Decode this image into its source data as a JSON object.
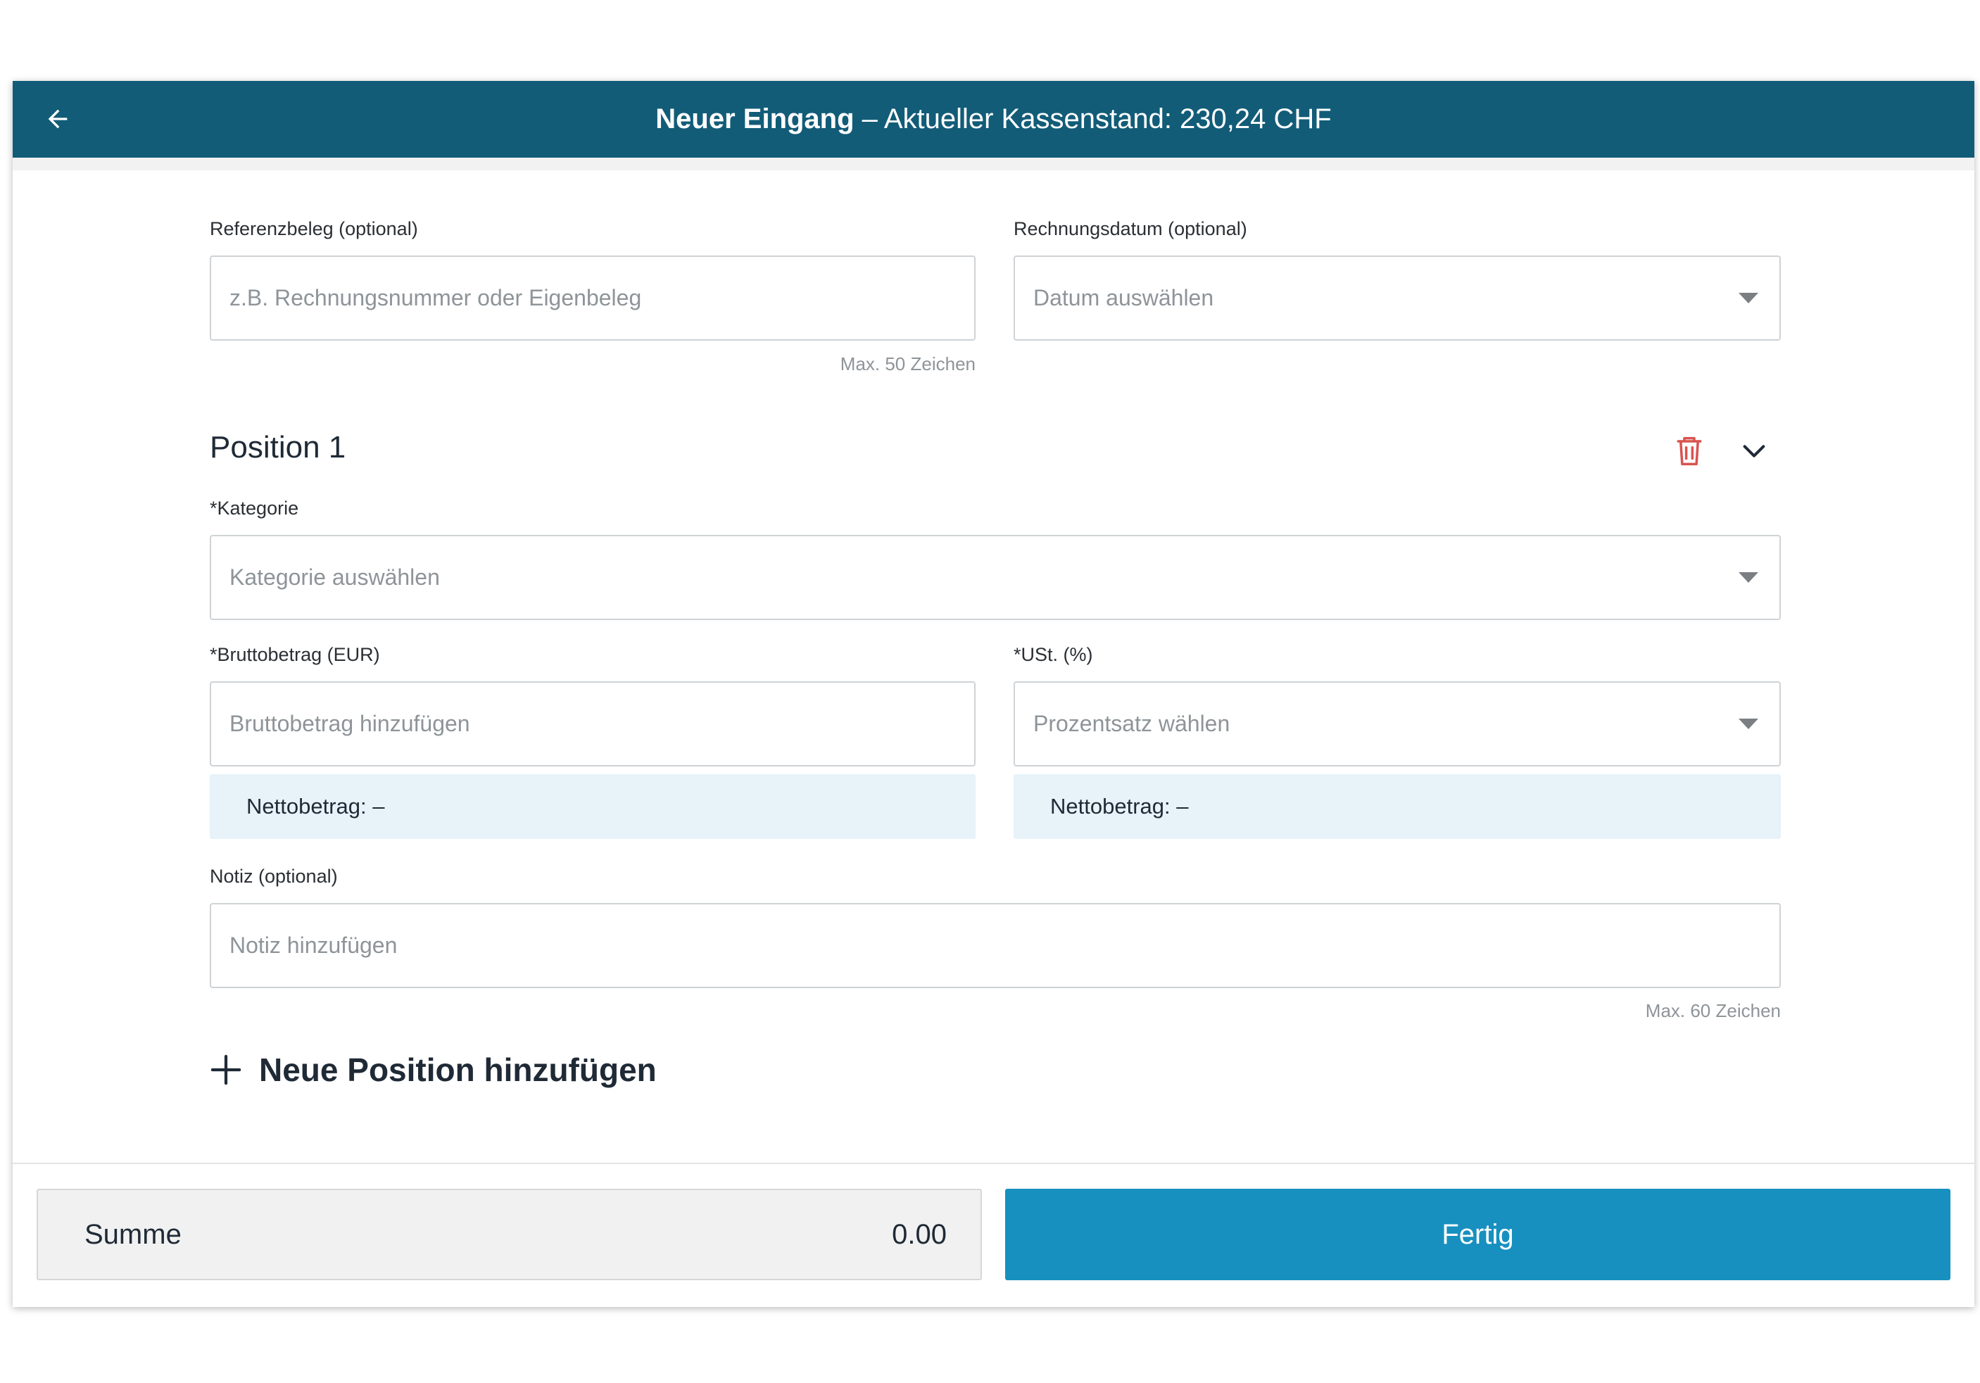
{
  "header": {
    "title_strong": "Neuer Eingang",
    "title_rest": " – Aktueller Kassenstand: 230,24 CHF",
    "back_icon": "arrow-left-icon"
  },
  "form": {
    "referenz": {
      "label": "Referenzbeleg (optional)",
      "placeholder": "z.B. Rechnungsnummer oder Eigenbeleg",
      "value": "",
      "hint": "Max. 50 Zeichen"
    },
    "rechnungsdatum": {
      "label": "Rechnungsdatum (optional)",
      "placeholder": "Datum auswählen"
    },
    "position": {
      "title": "Position 1",
      "delete_icon": "trash-icon",
      "collapse_icon": "chevron-down-icon",
      "delete_color": "#d9534f",
      "kategorie": {
        "label": "*Kategorie",
        "placeholder": "Kategorie auswählen"
      },
      "brutto": {
        "label": "*Bruttobetrag (EUR)",
        "placeholder": "Bruttobetrag hinzufügen",
        "value": "",
        "netto": "Nettobetrag: –"
      },
      "ust": {
        "label": "*USt. (%)",
        "placeholder": "Prozentsatz wählen",
        "netto": "Nettobetrag: –"
      },
      "notiz": {
        "label": "Notiz (optional)",
        "placeholder": "Notiz hinzufügen",
        "value": "",
        "hint": "Max. 60 Zeichen"
      }
    },
    "add_position": {
      "icon": "plus-icon",
      "label": "Neue Position hinzufügen"
    }
  },
  "footer": {
    "summe_label": "Summe",
    "summe_value": "0.00",
    "done_label": "Fertig"
  },
  "colors": {
    "header_bg": "#125c78",
    "primary_button": "#1790bf",
    "netto_bg": "#e7f2f9"
  }
}
